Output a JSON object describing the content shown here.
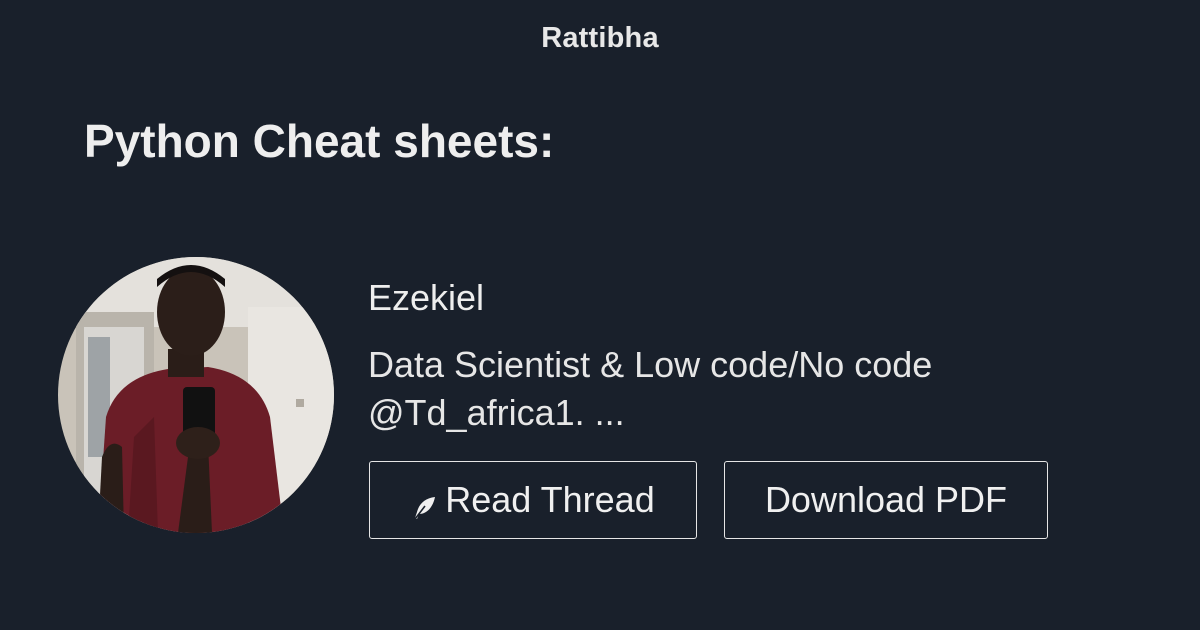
{
  "header": {
    "brand": "Rattibha"
  },
  "thread": {
    "title": "Python Cheat sheets:"
  },
  "author": {
    "name": "Ezekiel",
    "bio": "Data Scientist & Low code/No code @Td_africa1. ...",
    "avatar_icon": "profile-photo"
  },
  "actions": {
    "read_label": "Read Thread",
    "read_icon": "feather-icon",
    "download_label": "Download PDF"
  },
  "colors": {
    "background": "#19202b",
    "text": "#ececec",
    "button_border": "#e6e6e6"
  }
}
